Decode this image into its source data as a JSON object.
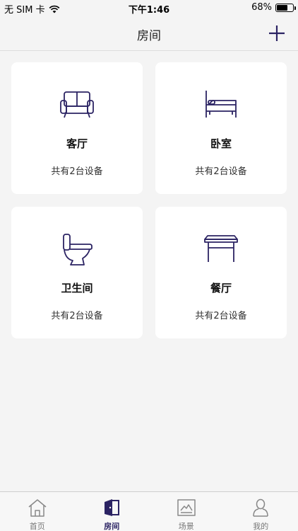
{
  "status_bar": {
    "carrier": "无 SIM 卡",
    "time": "下午1:46",
    "battery_percent": "68%",
    "battery_level": 0.68
  },
  "header": {
    "title": "房间",
    "add_icon": "plus-icon"
  },
  "rooms": [
    {
      "name": "客厅",
      "device_count": "共有2台设备",
      "icon": "sofa-icon"
    },
    {
      "name": "卧室",
      "device_count": "共有2台设备",
      "icon": "bed-icon"
    },
    {
      "name": "卫生间",
      "device_count": "共有2台设备",
      "icon": "toilet-icon"
    },
    {
      "name": "餐厅",
      "device_count": "共有2台设备",
      "icon": "table-icon"
    }
  ],
  "tabs": [
    {
      "label": "首页",
      "icon": "home-icon",
      "active": false
    },
    {
      "label": "房间",
      "icon": "door-icon",
      "active": true
    },
    {
      "label": "场景",
      "icon": "scene-icon",
      "active": false
    },
    {
      "label": "我的",
      "icon": "person-icon",
      "active": false
    }
  ],
  "colors": {
    "accent": "#2b2363",
    "background": "#f4f4f4",
    "card": "#ffffff"
  }
}
